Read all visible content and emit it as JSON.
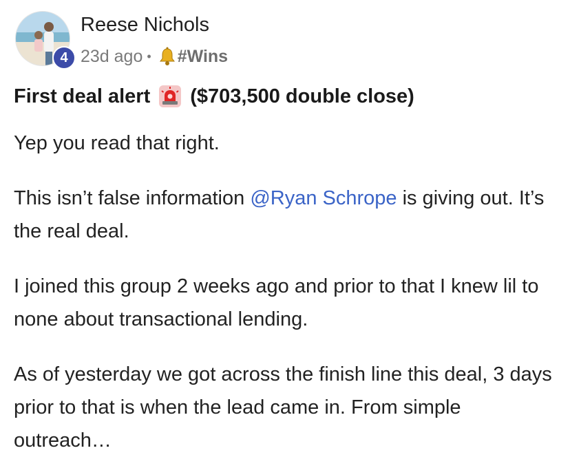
{
  "post": {
    "author": "Reese Nichols",
    "level": "4",
    "time_ago": "23d ago",
    "separator": "•",
    "category": "#Wins",
    "category_icon": "bell-icon",
    "title_before": "First deal alert",
    "title_icon": "siren-icon",
    "title_after": "($703,500 double close)",
    "paragraphs": {
      "p1": "Yep you read that right.",
      "p2_before": "This isn’t false information ",
      "p2_mention": "@Ryan Schrope",
      "p2_after": " is giving out. It’s the real deal.",
      "p3": "I joined this group 2 weeks ago and prior to that I knew lil to none about transactional lending.",
      "p4": "As of yesterday we got across the finish line this deal, 3 days prior to that is when the lead came in. From simple outreach…"
    }
  },
  "colors": {
    "mention": "#3b64c7",
    "level_badge": "#3c4ba8",
    "meta_text": "#7a7a7a"
  }
}
